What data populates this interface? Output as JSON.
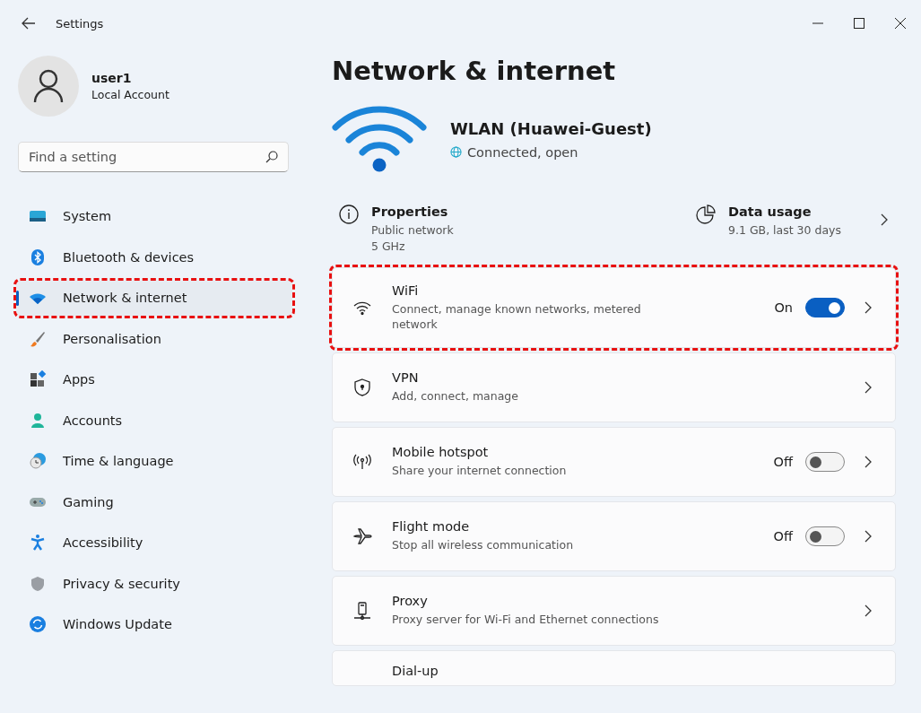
{
  "window": {
    "title": "Settings"
  },
  "account": {
    "name": "user1",
    "type": "Local Account"
  },
  "search": {
    "placeholder": "Find a setting"
  },
  "sidebar": {
    "items": [
      {
        "label": "System",
        "selected": false,
        "highlighted": false
      },
      {
        "label": "Bluetooth & devices",
        "selected": false,
        "highlighted": false
      },
      {
        "label": "Network & internet",
        "selected": true,
        "highlighted": true
      },
      {
        "label": "Personalisation",
        "selected": false,
        "highlighted": false
      },
      {
        "label": "Apps",
        "selected": false,
        "highlighted": false
      },
      {
        "label": "Accounts",
        "selected": false,
        "highlighted": false
      },
      {
        "label": "Time & language",
        "selected": false,
        "highlighted": false
      },
      {
        "label": "Gaming",
        "selected": false,
        "highlighted": false
      },
      {
        "label": "Accessibility",
        "selected": false,
        "highlighted": false
      },
      {
        "label": "Privacy & security",
        "selected": false,
        "highlighted": false
      },
      {
        "label": "Windows Update",
        "selected": false,
        "highlighted": false
      }
    ]
  },
  "page": {
    "title": "Network & internet"
  },
  "connection": {
    "name": "WLAN (Huawei-Guest)",
    "status": "Connected, open"
  },
  "properties": {
    "title": "Properties",
    "lines": [
      "Public network",
      "5 GHz"
    ]
  },
  "data_usage": {
    "title": "Data usage",
    "detail": "9.1 GB, last 30 days"
  },
  "settings": [
    {
      "kind": "toggle",
      "title": "WiFi",
      "subtitle": "Connect, manage known networks, metered network",
      "state_label": "On",
      "on": true,
      "highlighted": true
    },
    {
      "kind": "link",
      "title": "VPN",
      "subtitle": "Add, connect, manage",
      "highlighted": false
    },
    {
      "kind": "toggle",
      "title": "Mobile hotspot",
      "subtitle": "Share your internet connection",
      "state_label": "Off",
      "on": false,
      "highlighted": false
    },
    {
      "kind": "toggle",
      "title": "Flight mode",
      "subtitle": "Stop all wireless communication",
      "state_label": "Off",
      "on": false,
      "highlighted": false
    },
    {
      "kind": "link",
      "title": "Proxy",
      "subtitle": "Proxy server for Wi-Fi and Ethernet connections",
      "highlighted": false
    },
    {
      "kind": "partial",
      "title": "Dial-up",
      "highlighted": false
    }
  ]
}
